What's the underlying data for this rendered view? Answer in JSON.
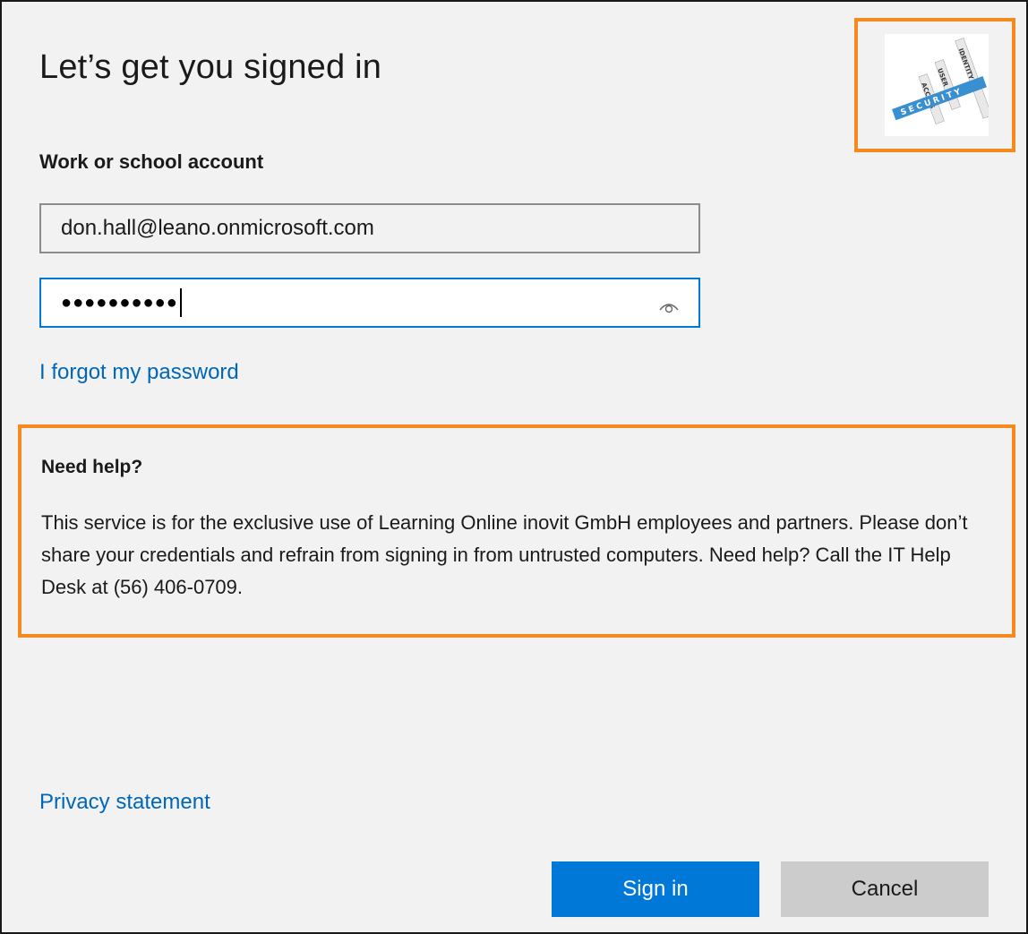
{
  "dialog": {
    "title": "Let’s get you signed in"
  },
  "logo": {
    "icon": "security-words-logo-icon",
    "words": [
      "ACCESS",
      "USER",
      "SECURITY",
      "IDENTITY"
    ],
    "accent_color": "#3a8fd0"
  },
  "form": {
    "account_label": "Work or school account",
    "email_value": "don.hall@leano.onmicrosoft.com",
    "password_mask": "●●●●●●●●●●",
    "reveal_icon": "eye-icon"
  },
  "links": {
    "forgot_password": "I forgot my password",
    "privacy_statement": "Privacy statement"
  },
  "help": {
    "title": "Need help?",
    "text": "This service is for the exclusive use of Learning Online inovit GmbH employees and partners. Please don’t share your credentials and refrain from signing in from untrusted computers. Need help? Call the IT Help Desk at (56) 406-0709."
  },
  "buttons": {
    "sign_in": "Sign in",
    "cancel": "Cancel"
  },
  "colors": {
    "accent": "#0078d7",
    "link": "#0067b8",
    "highlight": "#f58a1f",
    "background": "#f2f2f2"
  }
}
